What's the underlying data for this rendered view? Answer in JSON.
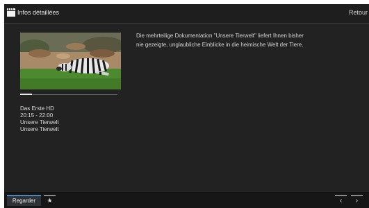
{
  "header": {
    "title": "Infos détaillées",
    "back_label": "Retour",
    "icon": "clapperboard-icon"
  },
  "program": {
    "thumbnail": "zebra-image",
    "progress": 0.12,
    "channel": "Das Erste HD",
    "time": "20:15 - 22:00",
    "title": "Unsere Tierwelt",
    "subtitle": "Unsere Tierwelt",
    "description": "Die mehrteilige Dokumentation \"Unsere Tierwelt\" liefert Ihnen bisher nie gezeigte, unglaubliche Einblicke in die heimische Welt der Tiere."
  },
  "footer": {
    "watch_label": "Regarder",
    "favorite_label": "★",
    "prev_label": "‹",
    "next_label": "›"
  },
  "colors": {
    "background": "#1c1c1c",
    "accent": "#4f87b5"
  }
}
